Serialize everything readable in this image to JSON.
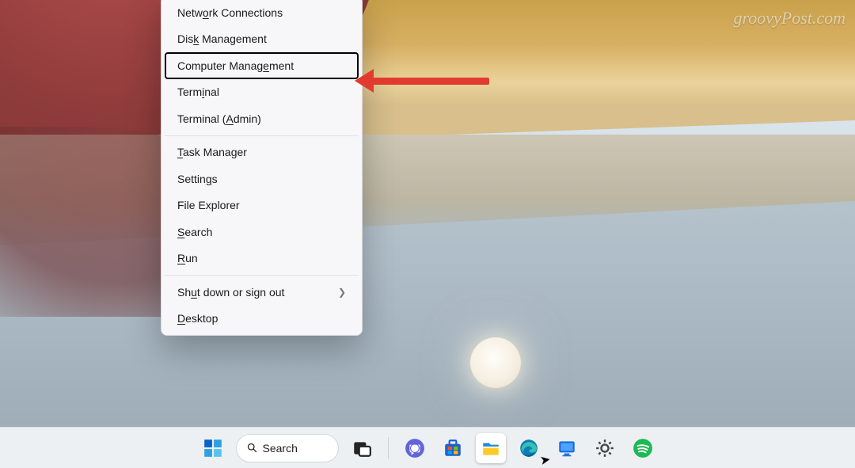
{
  "watermark": "groovyPost.com",
  "menu": {
    "items": [
      {
        "label": "Network Connections",
        "u": 4,
        "submenu": false,
        "highlight": false,
        "sep_after": false
      },
      {
        "label": "Disk Management",
        "u": 3,
        "submenu": false,
        "highlight": false,
        "sep_after": false
      },
      {
        "label": "Computer Management",
        "u": 14,
        "submenu": false,
        "highlight": true,
        "sep_after": false
      },
      {
        "label": "Terminal",
        "u": 4,
        "submenu": false,
        "highlight": false,
        "sep_after": false
      },
      {
        "label": "Terminal (Admin)",
        "u": 10,
        "submenu": false,
        "highlight": false,
        "sep_after": true
      },
      {
        "label": "Task Manager",
        "u": 0,
        "submenu": false,
        "highlight": false,
        "sep_after": false
      },
      {
        "label": "Settings",
        "u": 6,
        "submenu": false,
        "highlight": false,
        "sep_after": false
      },
      {
        "label": "File Explorer",
        "u": -1,
        "submenu": false,
        "highlight": false,
        "sep_after": false
      },
      {
        "label": "Search",
        "u": 0,
        "submenu": false,
        "highlight": false,
        "sep_after": false
      },
      {
        "label": "Run",
        "u": 0,
        "submenu": false,
        "highlight": false,
        "sep_after": true
      },
      {
        "label": "Shut down or sign out",
        "u": 2,
        "submenu": true,
        "highlight": false,
        "sep_after": false
      },
      {
        "label": "Desktop",
        "u": 0,
        "submenu": false,
        "highlight": false,
        "sep_after": false
      }
    ]
  },
  "taskbar": {
    "search_label": "Search",
    "items": [
      {
        "name": "start-button",
        "kind": "start"
      },
      {
        "name": "search-pill",
        "kind": "search"
      },
      {
        "name": "task-view-button",
        "kind": "taskview"
      },
      {
        "name": "divider",
        "kind": "divider"
      },
      {
        "name": "teams-icon",
        "kind": "chat"
      },
      {
        "name": "microsoft-store-icon",
        "kind": "store"
      },
      {
        "name": "file-explorer-icon",
        "kind": "explorer",
        "active": true
      },
      {
        "name": "edge-icon",
        "kind": "edge"
      },
      {
        "name": "monitor-app-icon",
        "kind": "monitor"
      },
      {
        "name": "settings-icon",
        "kind": "gear"
      },
      {
        "name": "spotify-icon",
        "kind": "spotify"
      }
    ]
  }
}
